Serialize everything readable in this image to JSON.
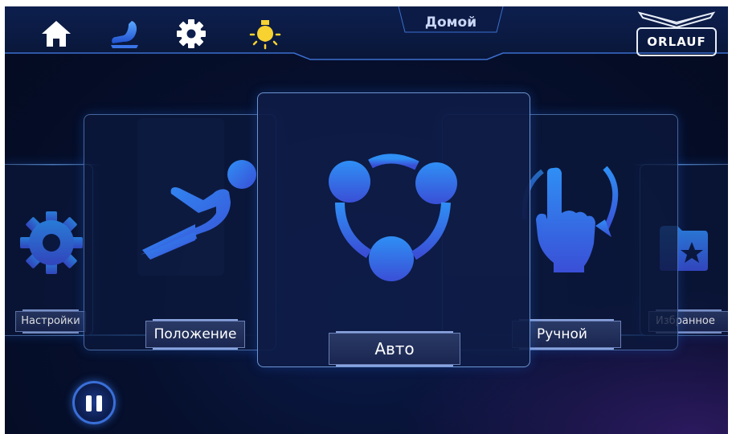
{
  "header": {
    "title": "Домой",
    "icons": [
      "home-icon",
      "massage-chair-icon",
      "gear-icon",
      "lightbulb-icon"
    ],
    "brand": "ORLAUF"
  },
  "modes": [
    {
      "label": "Настройки",
      "icon": "gear-icon"
    },
    {
      "label": "Положение",
      "icon": "recline-position-icon"
    },
    {
      "label": "Авто",
      "icon": "auto-cycle-icon",
      "selected": true
    },
    {
      "label": "Ручной",
      "icon": "hand-gesture-icon"
    },
    {
      "label": "Избранное",
      "icon": "favorite-folder-icon"
    }
  ],
  "controls": {
    "pause_icon": "pause-icon"
  },
  "colors": {
    "accent": "#3a7ff0",
    "icon_gradient_top": "#2f8ff5",
    "icon_gradient_bottom": "#3a4fd6",
    "bulb": "#f7d230",
    "background": "#06102e"
  }
}
